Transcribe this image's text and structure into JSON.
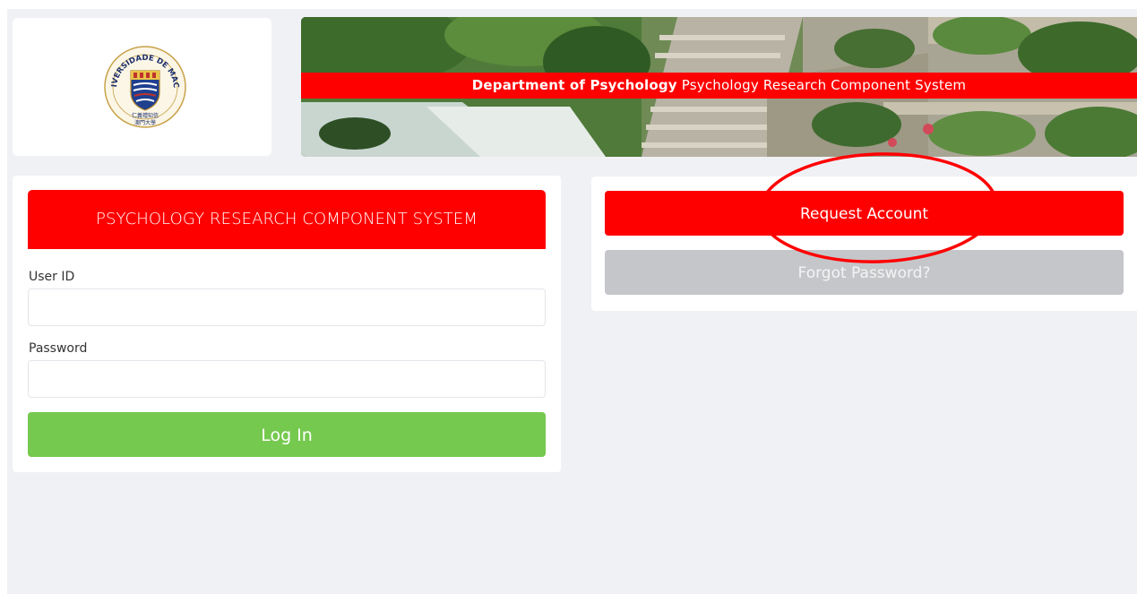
{
  "banner": {
    "department": "Department of Psychology",
    "system_name": "Psychology Research Component System"
  },
  "seal": {
    "arc_text": "UNIVERSIDADE DE MACAU",
    "motto": "仁義禮知信",
    "chinese_name": "澳門大學"
  },
  "login": {
    "header": "PSYCHOLOGY RESEARCH COMPONENT SYSTEM",
    "user_id_label": "User ID",
    "user_id_value": "",
    "password_label": "Password",
    "password_value": "",
    "login_button": "Log In"
  },
  "actions": {
    "request_account": "Request Account",
    "forgot_password": "Forgot Password?"
  },
  "colors": {
    "brand_red": "#ff0000",
    "login_green": "#76c94f",
    "forgot_gray": "#c4c6c9",
    "page_bg": "#f0f1f5"
  }
}
